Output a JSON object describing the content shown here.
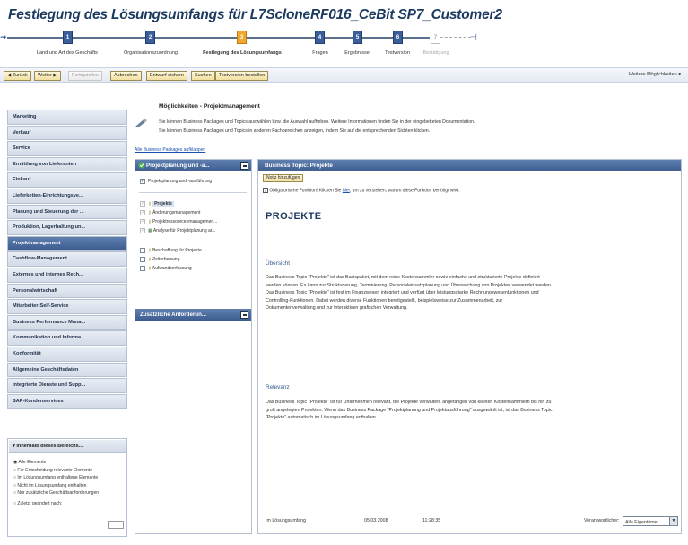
{
  "title": "Festlegung des Lösungsumfangs für L7ScloneRF016_CeBit SP7_Customer2",
  "roadmap": {
    "steps": [
      {
        "num": "1",
        "label": "Land und Art des Geschäfts",
        "state": "done"
      },
      {
        "num": "2",
        "label": "Organisationszuordnung",
        "state": "done"
      },
      {
        "num": "3",
        "label": "Festlegung des Lösungsumfangs",
        "state": "current"
      },
      {
        "num": "4",
        "label": "Fragen",
        "state": "done"
      },
      {
        "num": "5",
        "label": "Ergebnisse",
        "state": "done"
      },
      {
        "num": "6",
        "label": "Testversion",
        "state": "done"
      },
      {
        "num": "7",
        "label": "Bestätigung",
        "state": "future"
      }
    ]
  },
  "toolbar": {
    "back": "◀ Zurück",
    "next": "Weiter ▶",
    "finish": "Fertigstellen",
    "cancel": "Abbrechen",
    "save_draft": "Entwurf sichern",
    "search": "Suchen",
    "order_test": "Testversion bestellen",
    "more": "Weitere Möglichkeiten"
  },
  "sidebar": {
    "items": [
      "Marketing",
      "Verkauf",
      "Service",
      "Ermittlung von Lieferanten",
      "Einkauf",
      "Lieferketten-Einrichtungsve...",
      "Planung und Steuerung der ...",
      "Produktion, Lagerhaltung un...",
      "Projektmanagement",
      "Cashflow-Management",
      "Externes und internes Rech...",
      "Personalwirtschaft",
      "Mitarbeiter-Self-Service",
      "Business Performance Mana...",
      "Kommunikation und Informa...",
      "Konformität",
      "Allgemeine Geschäftsdaten",
      "Integrierte Dienste und Supp...",
      "SAP-Kundenservices"
    ],
    "active_index": 8
  },
  "filter": {
    "heading": "Innerhalb dieses Bereichs...",
    "options": [
      "Alle Elemente",
      "Für Entscheidung relevante Elemente",
      "Im Lösungsumfang enthaltene Elemente",
      "Nicht im Lösungsumfang enthalten",
      "Nur zusätzliche Geschäftsanforderungen",
      "Zuletzt geändert nach:"
    ]
  },
  "header": {
    "title": "Möglichkeiten - Projektmanagement",
    "line1": "Sie können Business Packages und Topics auswählen bzw. die Auswahl aufheben. Weitere Informationen finden Sie in der eingebetteten Dokumentation.",
    "line2": "Sie können Business Packages und Topics in anderen Fachbereichen anzeigen, indem Sie auf die entsprechenden Sichten klicken.",
    "link": "Alle Business Packages aufklappen"
  },
  "package": {
    "title": "Projektplanung und -a...",
    "main_item": "Projektplanung und -ausführung",
    "items": [
      "Projekte",
      "Änderungsmanagement",
      "Projektressourcenmanagemen...",
      "Analyse für Projektplanung ar..."
    ],
    "items2": [
      "Beschaffung für Projekte",
      "Zeiterfassung",
      "Aufwandserfassung"
    ],
    "additional": "Zusätzliche Anforderun..."
  },
  "topic": {
    "header": "Business Topic: Projekte",
    "note_button": "Notiz hinzufügen",
    "mandatory_pre": "Obligatorische Funktion! Klicken Sie ",
    "mandatory_link": "hier",
    "mandatory_post": ", um zu verstehen, warum diese Funktion benötigt wird.",
    "big_title": "PROJEKTE",
    "overview_heading": "Übersicht",
    "overview_text": "Das Business Topic \"Projekte\" ist das Basispaket, mit dem reine Kostensammler sowie einfache und strukturierte Projekte definiert werden können. Es kann zur Strukturierung, Terminierung, Personaleinsatzplanung und Überwachung von Projekten verwendet werden. Das Business Topic \"Projekte\" ist fest im Finanzwesen integriert und verfügt über leistungsstarke Rechnungswesenfunktionen und Controlling-Funktionen. Dabei werden diverse Funktionen bereitgestellt, beispielsweise zur Zusammenarbeit, zur Dokumentenverwaltung und zur interaktiven grafischen Verwaltung.",
    "relevance_heading": "Relevanz",
    "relevance_text": "Das Business Topic \"Projekte\" ist für Unternehmen relevant, die Projekte verwalten, angefangen von kleinen Kostensammlern bis hin zu groß angelegten Projekten. Wenn das Business Package \"Projektplanung und Projektausführung\" ausgewählt ist, ist das Business Topic \"Projekte\" automatisch im Lösungsumfang enthalten.",
    "footer_status": "Im Lösungsumfang",
    "footer_date": "05.03.2008",
    "footer_time": "11:28:35",
    "footer_label": "Verantwortlicher:",
    "footer_select": "Alle Eigentümer"
  }
}
